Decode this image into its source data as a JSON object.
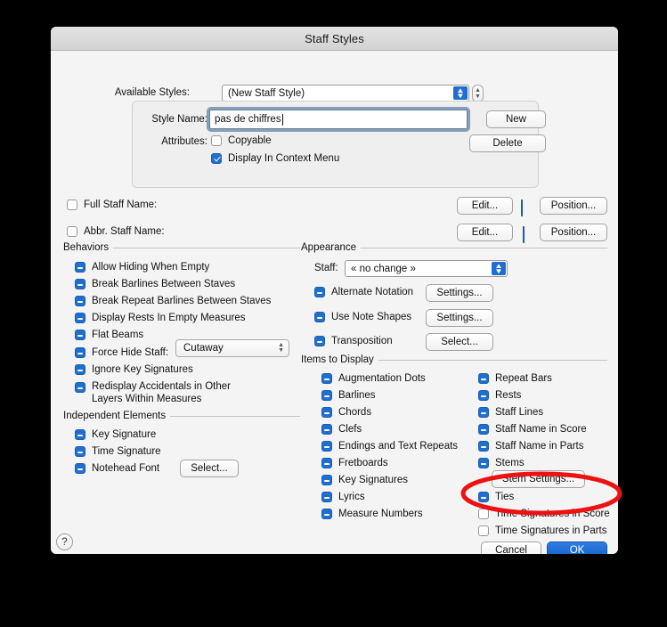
{
  "window": {
    "title": "Staff Styles"
  },
  "available_styles": {
    "label": "Available Styles:",
    "value": "(New Staff Style)",
    "stepper_up": "⌃",
    "stepper_down": "⌄"
  },
  "style_group": {
    "style_name_label": "Style Name:",
    "style_name_value": "pas de chiffres",
    "attributes_label": "Attributes:",
    "new_button": "New",
    "delete_button": "Delete",
    "copyable": {
      "label": "Copyable",
      "state": "off"
    },
    "display_in_context_menu": {
      "label": "Display In Context Menu",
      "state": "on"
    }
  },
  "staff_names": [
    {
      "label": "Full Staff Name:",
      "state": "off",
      "edit": "Edit...",
      "position": "Position...",
      "link_state": "mixed"
    },
    {
      "label": "Abbr. Staff Name:",
      "state": "off",
      "edit": "Edit...",
      "position": "Position...",
      "link_state": "mixed"
    }
  ],
  "behaviors": {
    "header": "Behaviors",
    "items": [
      {
        "label": "Allow Hiding When Empty",
        "state": "mixed"
      },
      {
        "label": "Break Barlines Between Staves",
        "state": "mixed"
      },
      {
        "label": "Break Repeat Barlines Between Staves",
        "state": "mixed"
      },
      {
        "label": "Display Rests In Empty Measures",
        "state": "mixed"
      },
      {
        "label": "Flat Beams",
        "state": "mixed"
      },
      {
        "label": "Force Hide Staff:",
        "state": "mixed"
      },
      {
        "label": "Ignore Key Signatures",
        "state": "mixed"
      },
      {
        "label": "Redisplay Accidentals in Other Layers Within Measures",
        "state": "mixed"
      }
    ],
    "force_hide_staff_value": "Cutaway"
  },
  "independent_elements": {
    "header": "Independent Elements",
    "items": [
      {
        "label": "Key Signature",
        "state": "mixed"
      },
      {
        "label": "Time Signature",
        "state": "mixed"
      },
      {
        "label": "Notehead Font",
        "state": "mixed"
      }
    ],
    "select_button": "Select..."
  },
  "appearance": {
    "header": "Appearance",
    "staff_label": "Staff:",
    "staff_value": "« no change »",
    "rows": [
      {
        "label": "Alternate Notation",
        "state": "mixed",
        "button": "Settings..."
      },
      {
        "label": "Use Note Shapes",
        "state": "mixed",
        "button": "Settings..."
      },
      {
        "label": "Transposition",
        "state": "mixed",
        "button": "Select..."
      }
    ]
  },
  "items_to_display": {
    "header": "Items to Display",
    "left_column": [
      {
        "label": "Augmentation Dots",
        "state": "mixed"
      },
      {
        "label": "Barlines",
        "state": "mixed"
      },
      {
        "label": "Chords",
        "state": "mixed"
      },
      {
        "label": "Clefs",
        "state": "mixed"
      },
      {
        "label": "Endings and Text Repeats",
        "state": "mixed"
      },
      {
        "label": "Fretboards",
        "state": "mixed"
      },
      {
        "label": "Key Signatures",
        "state": "mixed"
      },
      {
        "label": "Lyrics",
        "state": "mixed"
      },
      {
        "label": "Measure Numbers",
        "state": "mixed"
      }
    ],
    "right_column": [
      {
        "label": "Repeat Bars",
        "state": "mixed"
      },
      {
        "label": "Rests",
        "state": "mixed"
      },
      {
        "label": "Staff Lines",
        "state": "mixed"
      },
      {
        "label": "Staff Name in Score",
        "state": "mixed"
      },
      {
        "label": "Staff Name in Parts",
        "state": "mixed"
      },
      {
        "label": "Stems",
        "state": "mixed"
      },
      {
        "label": "Ties",
        "state": "mixed"
      },
      {
        "label": "Time Signatures in Score",
        "state": "off"
      },
      {
        "label": "Time Signatures in Parts",
        "state": "off"
      }
    ],
    "stem_settings_button": "Stem Settings..."
  },
  "footer": {
    "help": "?",
    "cancel": "Cancel",
    "ok": "OK"
  },
  "annotation": {
    "shape": "red-ellipse",
    "color": "#ee1111",
    "targets": [
      "Time Signatures in Score",
      "Time Signatures in Parts"
    ]
  },
  "colors": {
    "accent": "#1f6fd0",
    "default_button": "#1561c8",
    "dialog_bg": "#f4f4f4",
    "titlebar": "#d9d9d9",
    "annotation_red": "#ee1111",
    "backdrop": "#000000"
  }
}
